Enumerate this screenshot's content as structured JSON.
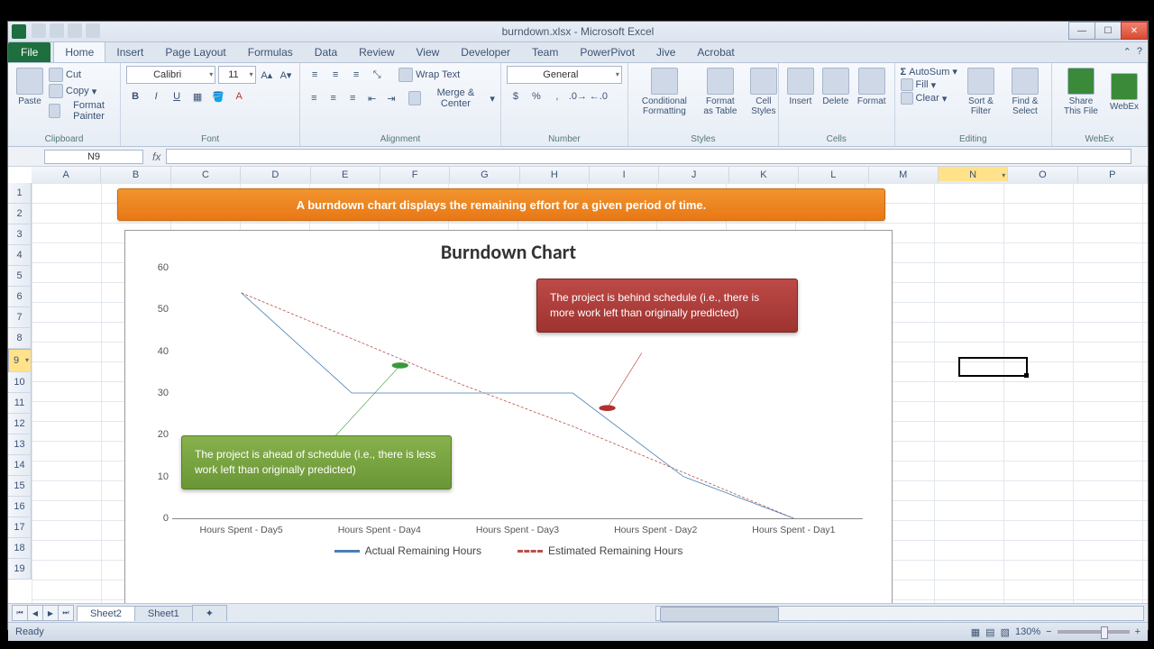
{
  "title": "burndown.xlsx - Microsoft Excel",
  "tabs": {
    "file": "File",
    "list": [
      "Home",
      "Insert",
      "Page Layout",
      "Formulas",
      "Data",
      "Review",
      "View",
      "Developer",
      "Team",
      "PowerPivot",
      "Jive",
      "Acrobat"
    ],
    "active": 0
  },
  "ribbon": {
    "clipboard": {
      "label": "Clipboard",
      "paste": "Paste",
      "cut": "Cut",
      "copy": "Copy",
      "fp": "Format Painter"
    },
    "font": {
      "label": "Font",
      "name": "Calibri",
      "size": "11"
    },
    "alignment": {
      "label": "Alignment",
      "wrap": "Wrap Text",
      "merge": "Merge & Center"
    },
    "number": {
      "label": "Number",
      "format": "General"
    },
    "styles": {
      "label": "Styles",
      "cf": "Conditional Formatting",
      "fat": "Format as Table",
      "cs": "Cell Styles"
    },
    "cells": {
      "label": "Cells",
      "ins": "Insert",
      "del": "Delete",
      "fmt": "Format"
    },
    "editing": {
      "label": "Editing",
      "sum": "AutoSum",
      "fill": "Fill",
      "clear": "Clear",
      "sort": "Sort & Filter",
      "find": "Find & Select"
    },
    "webex": {
      "label": "WebEx",
      "share": "Share This File",
      "wx": "WebEx"
    }
  },
  "namebox": "N9",
  "cols": [
    "A",
    "B",
    "C",
    "D",
    "E",
    "F",
    "G",
    "H",
    "I",
    "J",
    "K",
    "L",
    "M",
    "N",
    "O",
    "P"
  ],
  "rows": [
    "1",
    "2",
    "3",
    "4",
    "5",
    "6",
    "7",
    "8",
    "9",
    "10",
    "11",
    "12",
    "13",
    "14",
    "15",
    "16",
    "17",
    "18",
    "19"
  ],
  "banner": "A burndown chart displays the remaining effort for a given period of time.",
  "chart_data": {
    "type": "line",
    "title": "Burndown Chart",
    "ylabel": "",
    "xlabel": "",
    "ylim": [
      0,
      60
    ],
    "yticks": [
      0,
      10,
      20,
      30,
      40,
      50,
      60
    ],
    "categories": [
      "Hours Spent - Day5",
      "Hours Spent - Day4",
      "Hours Spent - Day3",
      "Hours Spent - Day2",
      "Hours Spent - Day1"
    ],
    "series": [
      {
        "name": "Actual Remaining Hours",
        "color": "#4a7fb5",
        "style": "solid",
        "values": [
          54,
          30,
          30,
          30,
          10,
          0
        ]
      },
      {
        "name": "Estimated Remaining Hours",
        "color": "#b5524a",
        "style": "dashed",
        "values": [
          54,
          43,
          32,
          22,
          11,
          0
        ]
      }
    ],
    "annotations": [
      {
        "text": "The project is ahead of schedule (i.e., there is less work left than originally predicted)",
        "color": "green"
      },
      {
        "text": "The project is behind schedule (i.e., there is more work left than originally predicted)",
        "color": "red"
      }
    ]
  },
  "sheets": {
    "active": "Sheet2",
    "list": [
      "Sheet2",
      "Sheet1"
    ]
  },
  "status": {
    "ready": "Ready",
    "zoom": "130%"
  }
}
